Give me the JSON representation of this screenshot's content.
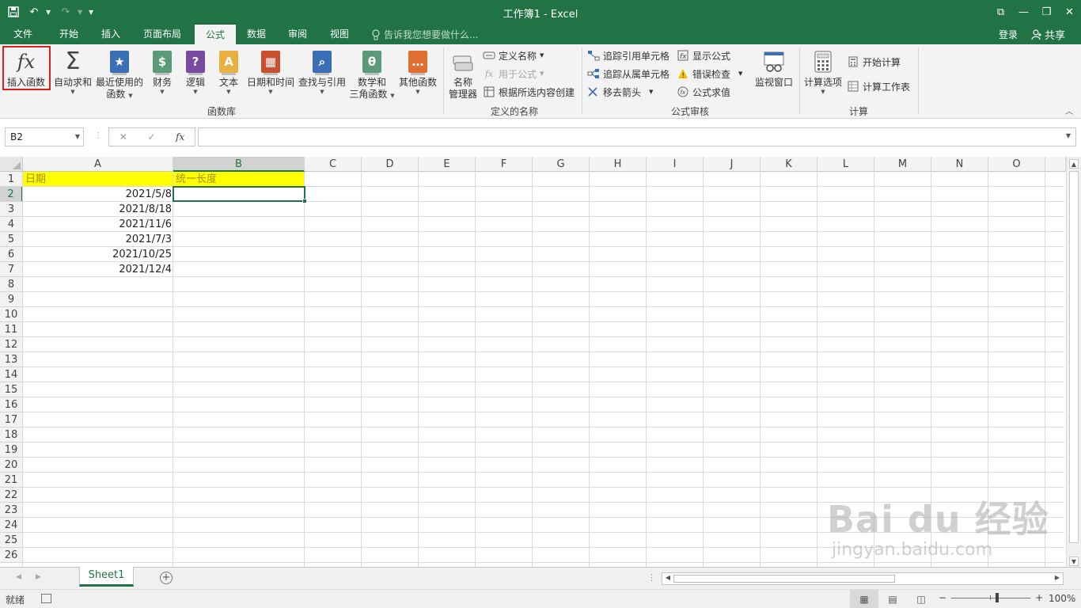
{
  "window": {
    "title": "工作簿1 - Excel",
    "controls": [
      "⧉",
      "—",
      "❐",
      "✕"
    ]
  },
  "qat": {
    "undo": "↶",
    "redo": "↷",
    "customize": "▼"
  },
  "tabs": [
    {
      "label": "文件",
      "active": false
    },
    {
      "label": "开始",
      "active": false
    },
    {
      "label": "插入",
      "active": false
    },
    {
      "label": "页面布局",
      "active": false
    },
    {
      "label": "公式",
      "active": true
    },
    {
      "label": "数据",
      "active": false
    },
    {
      "label": "审阅",
      "active": false
    },
    {
      "label": "视图",
      "active": false
    }
  ],
  "tell_me": "告诉我您想要做什么...",
  "sign_in": "登录",
  "share": "共享",
  "ribbon": {
    "function_library": {
      "label": "函数库",
      "insert_function": "插入函数",
      "autosum": "自动求和",
      "recent_1": "最近使用的",
      "recent_2": "函数",
      "financial": "财务",
      "logical": "逻辑",
      "text": "文本",
      "datetime": "日期和时间",
      "lookup": "查找与引用",
      "math_1": "数学和",
      "math_2": "三角函数",
      "more": "其他函数"
    },
    "defined_names": {
      "label": "定义的名称",
      "name_manager_1": "名称",
      "name_manager_2": "管理器",
      "define_name": "定义名称",
      "use_in_formula": "用于公式",
      "create_from_selection": "根据所选内容创建"
    },
    "formula_auditing": {
      "label": "公式审核",
      "trace_precedents": "追踪引用单元格",
      "trace_dependents": "追踪从属单元格",
      "remove_arrows": "移去箭头",
      "show_formulas": "显示公式",
      "error_checking": "错误检查",
      "evaluate_formula": "公式求值",
      "watch_window": "监视窗口"
    },
    "calculation": {
      "label": "计算",
      "options": "计算选项",
      "calc_now": "开始计算",
      "calc_sheet": "计算工作表"
    }
  },
  "formula_bar": {
    "name_box": "B2",
    "value": "",
    "fx": "fx",
    "cancel": "✕",
    "enter": "✓"
  },
  "columns": [
    "A",
    "B",
    "C",
    "D",
    "E",
    "F",
    "G",
    "H",
    "I",
    "J",
    "K",
    "L",
    "M",
    "N",
    "O"
  ],
  "rows": [
    "1",
    "2",
    "3",
    "4",
    "5",
    "6",
    "7",
    "8",
    "9",
    "10",
    "11",
    "12",
    "13",
    "14",
    "15",
    "16",
    "17",
    "18",
    "19",
    "20",
    "21",
    "22",
    "23",
    "24",
    "25",
    "26"
  ],
  "cells": {
    "A1": "日期",
    "B1": "统一长度",
    "A2": "2021/5/8",
    "A3": "2021/8/18",
    "A4": "2021/11/6",
    "A5": "2021/7/3",
    "A6": "2021/10/25",
    "A7": "2021/12/4"
  },
  "colors": {
    "accent": "#217346",
    "header_fill": "#ffff00",
    "highlight_box": "#e02020"
  },
  "sheets": [
    {
      "name": "Sheet1",
      "active": true
    }
  ],
  "status": {
    "ready": "就绪",
    "zoom": "100%",
    "zoom_minus": "−",
    "zoom_plus": "+"
  },
  "watermark": {
    "main": "Bai du 经验",
    "sub": "jingyan.baidu.com"
  }
}
